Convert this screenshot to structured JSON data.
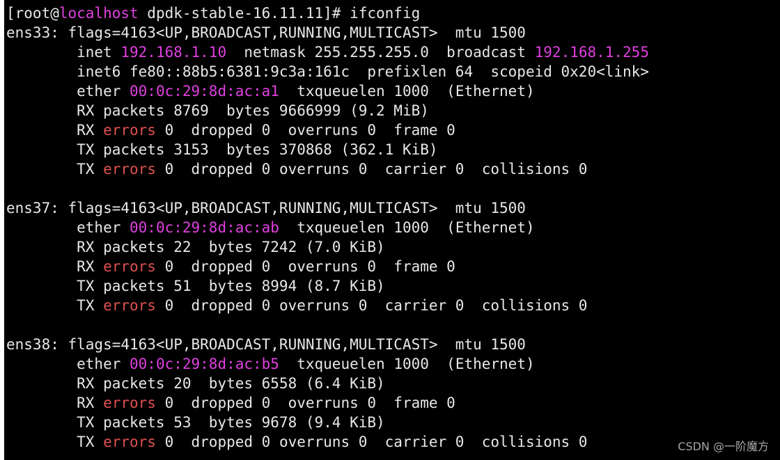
{
  "colors": {
    "background": "#000000",
    "text": "#e8e8e8",
    "highlight_magenta": "#e040e0",
    "highlight_red": "#e05050"
  },
  "terminal": {
    "lines": [
      [
        {
          "t": "[root@"
        },
        {
          "t": "localhost",
          "c": "#e040e0"
        },
        {
          "t": " dpdk-stable-16.11.11]# ifconfig"
        }
      ],
      [
        {
          "t": "ens33: flags=4163<UP,BROADCAST,RUNNING,MULTICAST>  mtu 1500"
        }
      ],
      [
        {
          "t": "        inet "
        },
        {
          "t": "192.168.1.10",
          "c": "#e040e0"
        },
        {
          "t": "  netmask 255.255.255.0  broadcast "
        },
        {
          "t": "192.168.1.255",
          "c": "#e040e0"
        }
      ],
      [
        {
          "t": "        inet6 fe80::88b5:6381:9c3a:161c  prefixlen 64  scopeid 0x20<link>"
        }
      ],
      [
        {
          "t": "        ether "
        },
        {
          "t": "00:0c:29:8d:ac:a1",
          "c": "#e040e0"
        },
        {
          "t": "  txqueuelen 1000  (Ethernet)"
        }
      ],
      [
        {
          "t": "        RX packets 8769  bytes 9666999 (9.2 MiB)"
        }
      ],
      [
        {
          "t": "        RX "
        },
        {
          "t": "errors",
          "c": "#e05050"
        },
        {
          "t": " 0  dropped 0  overruns 0  frame 0"
        }
      ],
      [
        {
          "t": "        TX packets 3153  bytes 370868 (362.1 KiB)"
        }
      ],
      [
        {
          "t": "        TX "
        },
        {
          "t": "errors",
          "c": "#e05050"
        },
        {
          "t": " 0  dropped 0 overruns 0  carrier 0  collisions 0"
        }
      ],
      [
        {
          "t": ""
        }
      ],
      [
        {
          "t": "ens37: flags=4163<UP,BROADCAST,RUNNING,MULTICAST>  mtu 1500"
        }
      ],
      [
        {
          "t": "        ether "
        },
        {
          "t": "00:0c:29:8d:ac:ab",
          "c": "#e040e0"
        },
        {
          "t": "  txqueuelen 1000  (Ethernet)"
        }
      ],
      [
        {
          "t": "        RX packets 22  bytes 7242 (7.0 KiB)"
        }
      ],
      [
        {
          "t": "        RX "
        },
        {
          "t": "errors",
          "c": "#e05050"
        },
        {
          "t": " 0  dropped 0  overruns 0  frame 0"
        }
      ],
      [
        {
          "t": "        TX packets 51  bytes 8994 (8.7 KiB)"
        }
      ],
      [
        {
          "t": "        TX "
        },
        {
          "t": "errors",
          "c": "#e05050"
        },
        {
          "t": " 0  dropped 0 overruns 0  carrier 0  collisions 0"
        }
      ],
      [
        {
          "t": ""
        }
      ],
      [
        {
          "t": "ens38: flags=4163<UP,BROADCAST,RUNNING,MULTICAST>  mtu 1500"
        }
      ],
      [
        {
          "t": "        ether "
        },
        {
          "t": "00:0c:29:8d:ac:b5",
          "c": "#e040e0"
        },
        {
          "t": "  txqueuelen 1000  (Ethernet)"
        }
      ],
      [
        {
          "t": "        RX packets 20  bytes 6558 (6.4 KiB)"
        }
      ],
      [
        {
          "t": "        RX "
        },
        {
          "t": "errors",
          "c": "#e05050"
        },
        {
          "t": " 0  dropped 0  overruns 0  frame 0"
        }
      ],
      [
        {
          "t": "        TX packets 53  bytes 9678 (9.4 KiB)"
        }
      ],
      [
        {
          "t": "        TX "
        },
        {
          "t": "errors",
          "c": "#e05050"
        },
        {
          "t": " 0  dropped 0 overruns 0  carrier 0  collisions 0"
        }
      ]
    ]
  },
  "watermark": "CSDN @一阶魔方"
}
